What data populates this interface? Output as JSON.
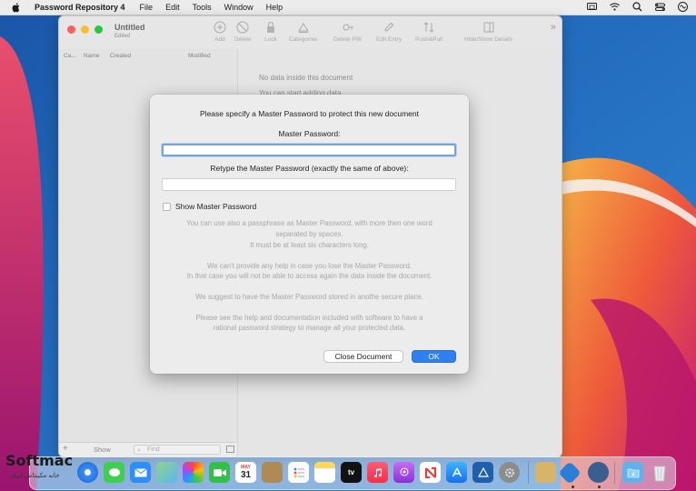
{
  "menubar": {
    "app_name": "Password Repository 4",
    "menus": [
      "File",
      "Edit",
      "Tools",
      "Window",
      "Help"
    ]
  },
  "window": {
    "title": "Untitled",
    "subtitle": "Edited",
    "toolbar": [
      "Add",
      "Delete",
      "Lock",
      "Categories",
      "Delete PW",
      "Edit Entry",
      "Push&Pull",
      "Hide/Show Details"
    ],
    "columns": [
      "Ca...",
      "Name",
      "Created",
      "Modified"
    ],
    "empty_lines": [
      "No data inside this document",
      "You can start adding data"
    ],
    "bottom": {
      "plus": "+",
      "show": "Show",
      "search_placeholder": "Find"
    }
  },
  "dialog": {
    "heading": "Please specify a Master Password to protect this new document",
    "master_label": "Master Password:",
    "master_value": "",
    "retype_label": "Retype the Master Password (exactly the same of above):",
    "retype_value": "",
    "show_checkbox": "Show Master Password",
    "show_checked": false,
    "help": [
      "You can use also a passphrase as Master Password, with more then one word",
      "separated by spaces.",
      "It must be at least six characters long.",
      "We can't provide any help in case you lose the Master Password.",
      "In that case you will not be able to access again the data inside the document.",
      "We suggest to have the Master Password stored in anothe secure place.",
      "Please see the help and documentation included with software to have a",
      "rational password strategy to manage all your protected data."
    ],
    "close_button": "Close Document",
    "ok_button": "OK"
  },
  "dock": {
    "calendar_month": "MAY",
    "calendar_day": "31",
    "tv_label": "tv"
  },
  "watermark": {
    "logo": "Softmac",
    "tagline": "خانه مکینتاش ایران"
  },
  "colors": {
    "accent": "#2f7ff0",
    "close": "#fe5f57",
    "minimize": "#febc2e",
    "maximize": "#28c840"
  }
}
